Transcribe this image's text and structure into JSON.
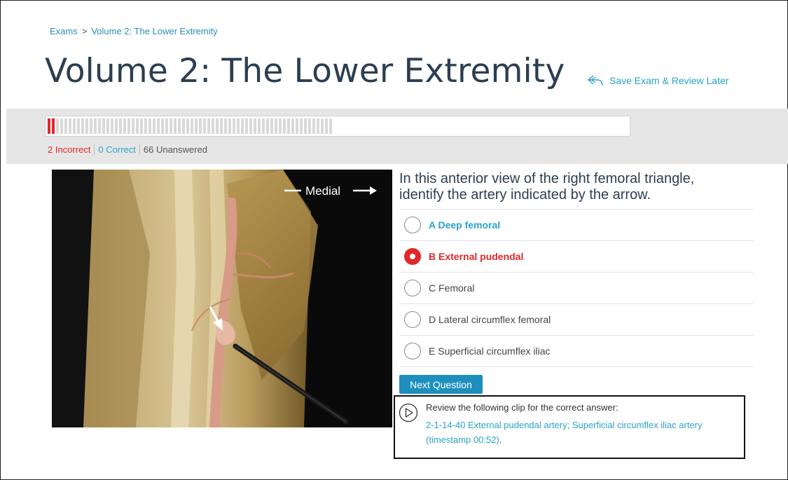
{
  "breadcrumb": {
    "root": "Exams",
    "separator": ">",
    "current": "Volume 2: The Lower Extremity"
  },
  "page_title": "Volume 2: The Lower Extremity",
  "save_link": {
    "label": "Save Exam & Review Later",
    "icon": "reply-arrow-icon"
  },
  "progress": {
    "total": 68,
    "incorrect": 2,
    "correct": 0
  },
  "score": {
    "incorrect_label": "2 Incorrect",
    "correct_label": "0 Correct",
    "unanswered_label": "66 Unanswered"
  },
  "image": {
    "overlay_label": "Medial"
  },
  "question": {
    "text": "In this anterior view of the right femoral triangle, identify the artery indicated by the arrow."
  },
  "options": [
    {
      "label": "A Deep femoral",
      "state": "hint"
    },
    {
      "label": "B External pudendal",
      "state": "wrong"
    },
    {
      "label": "C Femoral",
      "state": "none"
    },
    {
      "label": "D Lateral circumflex femoral",
      "state": "none"
    },
    {
      "label": "E Superficial circumflex iliac",
      "state": "none"
    }
  ],
  "next_button": {
    "label": "Next Question"
  },
  "review": {
    "intro": "Review the following clip for the correct answer:",
    "clip_link": "2-1-14-40 External pudendal artery; Superficial circumflex iliac artery (timestamp 00:52)",
    "trailing": "."
  },
  "colors": {
    "accent": "#2aa3c9",
    "incorrect": "#e0272a",
    "button": "#1e8fbd",
    "title": "#2c3e50"
  }
}
